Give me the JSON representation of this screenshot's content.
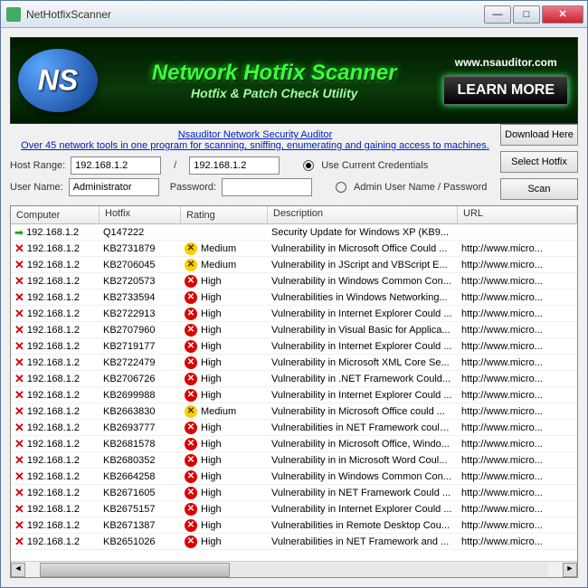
{
  "window": {
    "title": "NetHotfixScanner"
  },
  "banner": {
    "title": "Network Hotfix Scanner",
    "subtitle": "Hotfix & Patch Check Utility",
    "url": "www.nsauditor.com",
    "learn_more": "LEARN MORE"
  },
  "links": {
    "line1": "Nsauditor Network Security Auditor",
    "line2": "Over 45 network tools in one program for scanning, sniffing, enumerating and gaining access to machines."
  },
  "buttons": {
    "download": "Download Here",
    "select_hotfix": "Select Hotfix",
    "scan": "Scan"
  },
  "labels": {
    "host_range": "Host Range:",
    "slash": "/",
    "user_name": "User Name:",
    "password": "Password:",
    "use_current": "Use Current Credentials",
    "admin_creds": "Admin User Name / Password"
  },
  "inputs": {
    "host_from": "192.168.1.2",
    "host_to": "192.168.1.2",
    "user": "Administrator",
    "password": ""
  },
  "columns": {
    "computer": "Computer",
    "hotfix": "Hotfix",
    "rating": "Rating",
    "description": "Description",
    "url": "URL"
  },
  "rows": [
    {
      "status": "ok",
      "computer": "192.168.1.2",
      "hotfix": "Q147222",
      "rating": "",
      "desc": "Security Update for Windows XP (KB9...",
      "url": ""
    },
    {
      "status": "x",
      "computer": "192.168.1.2",
      "hotfix": "KB2731879",
      "rating": "Medium",
      "desc": "Vulnerability in Microsoft Office Could ...",
      "url": "http://www.micro..."
    },
    {
      "status": "x",
      "computer": "192.168.1.2",
      "hotfix": "KB2706045",
      "rating": "Medium",
      "desc": "Vulnerability in JScript and VBScript E...",
      "url": "http://www.micro..."
    },
    {
      "status": "x",
      "computer": "192.168.1.2",
      "hotfix": "KB2720573",
      "rating": "High",
      "desc": "Vulnerability in Windows Common Con...",
      "url": "http://www.micro..."
    },
    {
      "status": "x",
      "computer": "192.168.1.2",
      "hotfix": "KB2733594",
      "rating": "High",
      "desc": "Vulnerabilities in Windows Networking...",
      "url": "http://www.micro..."
    },
    {
      "status": "x",
      "computer": "192.168.1.2",
      "hotfix": "KB2722913",
      "rating": "High",
      "desc": "Vulnerability in Internet Explorer Could ...",
      "url": "http://www.micro..."
    },
    {
      "status": "x",
      "computer": "192.168.1.2",
      "hotfix": "KB2707960",
      "rating": "High",
      "desc": "Vulnerability in Visual Basic for Applica...",
      "url": "http://www.micro..."
    },
    {
      "status": "x",
      "computer": "192.168.1.2",
      "hotfix": "KB2719177",
      "rating": "High",
      "desc": "Vulnerability in Internet Explorer Could ...",
      "url": "http://www.micro..."
    },
    {
      "status": "x",
      "computer": "192.168.1.2",
      "hotfix": "KB2722479",
      "rating": "High",
      "desc": "Vulnerability in Microsoft XML Core Se...",
      "url": "http://www.micro..."
    },
    {
      "status": "x",
      "computer": "192.168.1.2",
      "hotfix": "KB2706726",
      "rating": "High",
      "desc": "Vulnerability in .NET Framework Could...",
      "url": "http://www.micro..."
    },
    {
      "status": "x",
      "computer": "192.168.1.2",
      "hotfix": "KB2699988",
      "rating": "High",
      "desc": "Vulnerability in Internet Explorer Could ...",
      "url": "http://www.micro..."
    },
    {
      "status": "x",
      "computer": "192.168.1.2",
      "hotfix": "KB2663830",
      "rating": "Medium",
      "desc": "Vulnerability in Microsoft Office could ...",
      "url": "http://www.micro..."
    },
    {
      "status": "x",
      "computer": "192.168.1.2",
      "hotfix": "KB2693777",
      "rating": "High",
      "desc": "Vulnerabilities in NET Framework could ...",
      "url": "http://www.micro..."
    },
    {
      "status": "x",
      "computer": "192.168.1.2",
      "hotfix": "KB2681578",
      "rating": "High",
      "desc": "Vulnerability in Microsoft Office, Windo...",
      "url": "http://www.micro..."
    },
    {
      "status": "x",
      "computer": "192.168.1.2",
      "hotfix": "KB2680352",
      "rating": "High",
      "desc": "Vulnerability in in Microsoft Word Coul...",
      "url": "http://www.micro..."
    },
    {
      "status": "x",
      "computer": "192.168.1.2",
      "hotfix": "KB2664258",
      "rating": "High",
      "desc": "Vulnerability in Windows Common Con...",
      "url": "http://www.micro..."
    },
    {
      "status": "x",
      "computer": "192.168.1.2",
      "hotfix": "KB2671605",
      "rating": "High",
      "desc": "Vulnerability in NET Framework Could ...",
      "url": "http://www.micro..."
    },
    {
      "status": "x",
      "computer": "192.168.1.2",
      "hotfix": "KB2675157",
      "rating": "High",
      "desc": "Vulnerability in Internet Explorer Could ...",
      "url": "http://www.micro..."
    },
    {
      "status": "x",
      "computer": "192.168.1.2",
      "hotfix": "KB2671387",
      "rating": "High",
      "desc": "Vulnerabilities in Remote Desktop Cou...",
      "url": "http://www.micro..."
    },
    {
      "status": "x",
      "computer": "192.168.1.2",
      "hotfix": "KB2651026",
      "rating": "High",
      "desc": "Vulnerabilities in NET Framework and ...",
      "url": "http://www.micro..."
    }
  ]
}
